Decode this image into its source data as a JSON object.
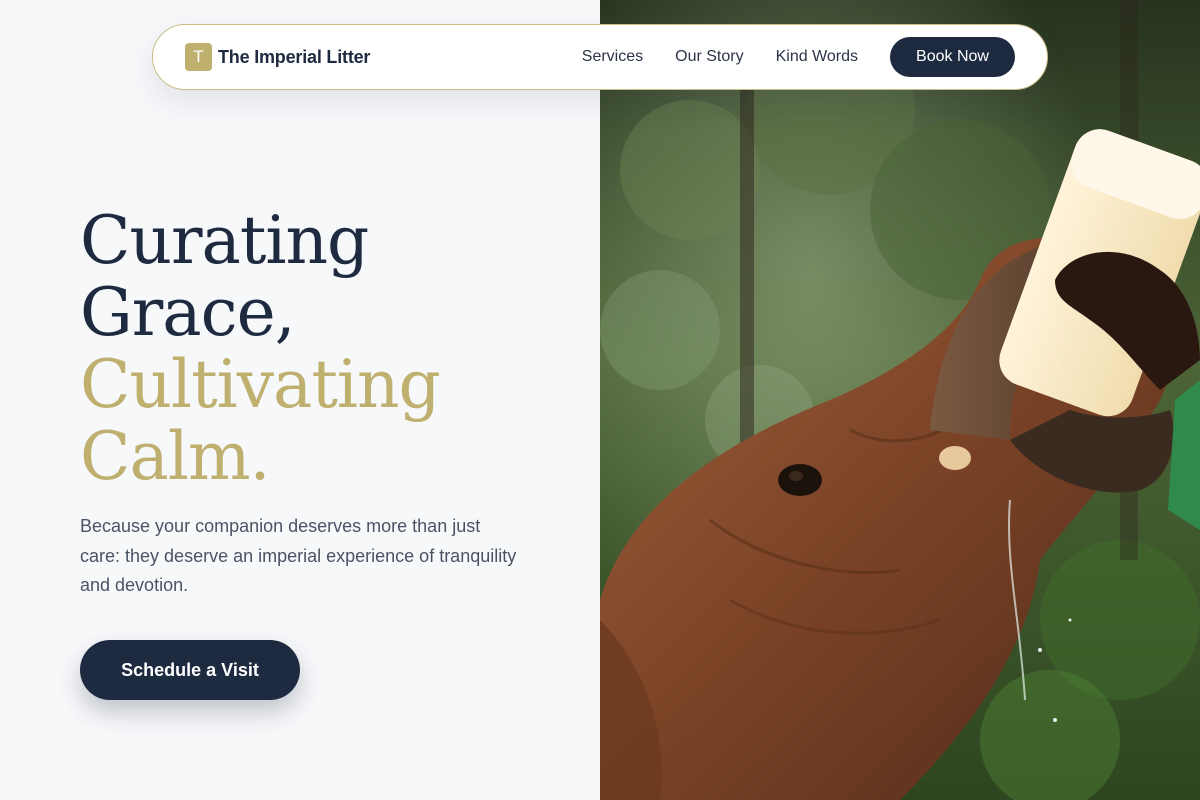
{
  "nav": {
    "brand_initial": "T",
    "brand_name": "The Imperial Litter",
    "links": [
      "Services",
      "Our Story",
      "Kind Words"
    ],
    "cta_label": "Book Now"
  },
  "hero": {
    "headline_line1": "Curating",
    "headline_line2": "Grace,",
    "headline_line3": "Cultivating",
    "headline_line4": "Calm.",
    "subtext": "Because your companion deserves more than just care: they deserve an imperial experience of tranquility and devotion.",
    "cta_label": "Schedule a Visit",
    "image_subject": "baby elephant being bottle-fed milk by a caretaker"
  },
  "colors": {
    "navy": "#1e2a40",
    "gold": "#bfb06f",
    "background": "#f7f8fa",
    "nav_border": "#c9be86"
  }
}
